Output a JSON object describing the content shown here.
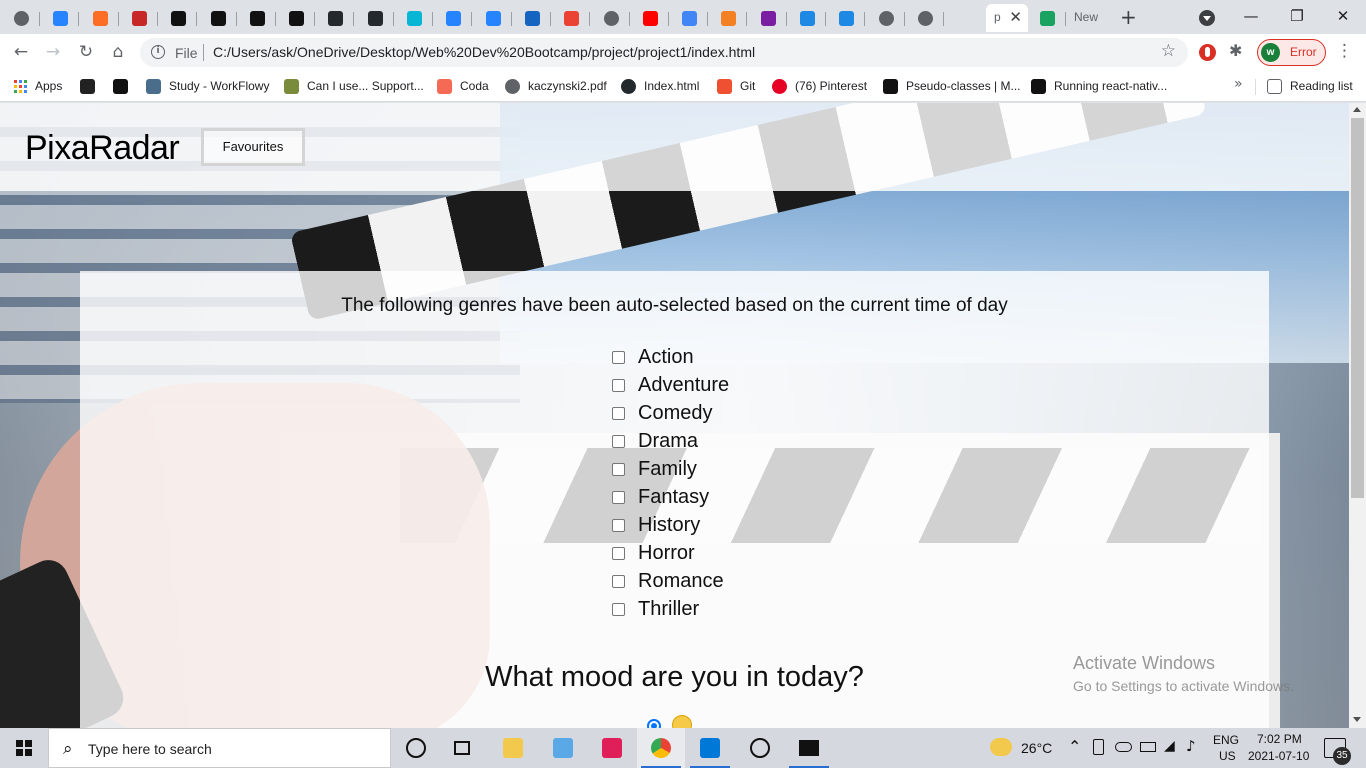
{
  "browser": {
    "active_tab_label": "p",
    "last_tab_label": "New",
    "new_tab_symbol": "+",
    "url_scheme": "File",
    "url": "C:/Users/ask/OneDrive/Desktop/Web%20Dev%20Bootcamp/project/project1/index.html",
    "profile_initial": "w",
    "profile_status": "Error",
    "accent_color": "#1a73e8",
    "error_color": "#d93025",
    "tab_favicons": [
      {
        "icon": "globe-icon",
        "color": "#5f6368"
      },
      {
        "icon": "jira-icon",
        "color": "#2684ff"
      },
      {
        "icon": "gitlab-icon",
        "color": "#fc6d26"
      },
      {
        "icon": "shield-icon",
        "color": "#c62828"
      },
      {
        "icon": "notion-icon",
        "color": "#111111"
      },
      {
        "icon": "notion-icon",
        "color": "#111111"
      },
      {
        "icon": "notion-icon",
        "color": "#111111"
      },
      {
        "icon": "notion-icon",
        "color": "#111111"
      },
      {
        "icon": "github-icon",
        "color": "#24292e"
      },
      {
        "icon": "github-icon",
        "color": "#24292e"
      },
      {
        "icon": "tailwind-icon",
        "color": "#06b6d4"
      },
      {
        "icon": "jira-icon",
        "color": "#2684ff"
      },
      {
        "icon": "jira-icon",
        "color": "#2684ff"
      },
      {
        "icon": "media-icon",
        "color": "#1565c0"
      },
      {
        "icon": "gmail-icon",
        "color": "#ea4335"
      },
      {
        "icon": "globe-icon",
        "color": "#5f6368"
      },
      {
        "icon": "youtube-icon",
        "color": "#ff0000"
      },
      {
        "icon": "google-icon",
        "color": "#4285f4"
      },
      {
        "icon": "stack-icon",
        "color": "#f48024"
      },
      {
        "icon": "graphql-icon",
        "color": "#7b1fa2"
      },
      {
        "icon": "blue-b-icon",
        "color": "#1e88e5"
      },
      {
        "icon": "blue-b-icon",
        "color": "#1e88e5"
      },
      {
        "icon": "globe-icon",
        "color": "#5f6368"
      },
      {
        "icon": "globe-icon",
        "color": "#5f6368"
      }
    ]
  },
  "bookmarks": [
    {
      "label": "Apps",
      "icon": "apps-grid-icon",
      "color": "#4285f4"
    },
    {
      "label": "",
      "icon": "dark-logo-icon",
      "color": "#222222"
    },
    {
      "label": "",
      "icon": "j-logo-icon",
      "color": "#111111"
    },
    {
      "label": "Study - WorkFlowy",
      "icon": "workflowy-icon",
      "color": "#4a6d8c"
    },
    {
      "label": "Can I use... Support...",
      "icon": "caniuse-icon",
      "color": "#7a8c3c"
    },
    {
      "label": "Coda",
      "icon": "coda-icon",
      "color": "#f46a54"
    },
    {
      "label": "kaczynski2.pdf",
      "icon": "globe-icon",
      "color": "#5f6368"
    },
    {
      "label": "Index.html",
      "icon": "github-icon",
      "color": "#24292e"
    },
    {
      "label": "Git",
      "icon": "git-icon",
      "color": "#f05032"
    },
    {
      "label": "(76) Pinterest",
      "icon": "pinterest-icon",
      "color": "#e60023"
    },
    {
      "label": "Pseudo-classes | M...",
      "icon": "mdn-icon",
      "color": "#111111"
    },
    {
      "label": "Running react-nativ...",
      "icon": "medium-icon",
      "color": "#111111"
    }
  ],
  "bookmarks_more": "»",
  "reading_list": "Reading list",
  "page": {
    "brand": "PixaRadar",
    "favourites_button": "Favourites",
    "intro": "The following genres have been auto-selected based on the current time of day",
    "genres": [
      {
        "label": "Action",
        "checked": false
      },
      {
        "label": "Adventure",
        "checked": false
      },
      {
        "label": "Comedy",
        "checked": false
      },
      {
        "label": "Drama",
        "checked": false
      },
      {
        "label": "Family",
        "checked": false
      },
      {
        "label": "Fantasy",
        "checked": false
      },
      {
        "label": "History",
        "checked": false
      },
      {
        "label": "Horror",
        "checked": false
      },
      {
        "label": "Romance",
        "checked": false
      },
      {
        "label": "Thriller",
        "checked": false
      }
    ],
    "mood_title": "What mood are you in today?",
    "mood_option_selected": true,
    "mood_option_icon": "smiling-face-icon"
  },
  "watermark": {
    "line1": "Activate Windows",
    "line2": "Go to Settings to activate Windows."
  },
  "taskbar": {
    "search_placeholder": "Type here to search",
    "weather_temp": "26°C",
    "language_line1": "ENG",
    "language_line2": "US",
    "time": "7:02 PM",
    "date": "2021-07-10",
    "notification_count": "35",
    "apps": [
      {
        "icon": "cortana-icon",
        "color": "#111111"
      },
      {
        "icon": "task-view-icon",
        "color": "#111111"
      },
      {
        "icon": "file-explorer-icon",
        "color": "#f2c94c"
      },
      {
        "icon": "notes-app-icon",
        "color": "#5aa9e6"
      },
      {
        "icon": "slack-icon",
        "color": "#e01e5a"
      },
      {
        "icon": "chrome-icon",
        "color": "#34a853"
      },
      {
        "icon": "vscode-icon",
        "color": "#0078d7"
      },
      {
        "icon": "emoji-app-icon",
        "color": "#111111"
      },
      {
        "icon": "terminal-icon",
        "color": "#111111"
      }
    ]
  }
}
